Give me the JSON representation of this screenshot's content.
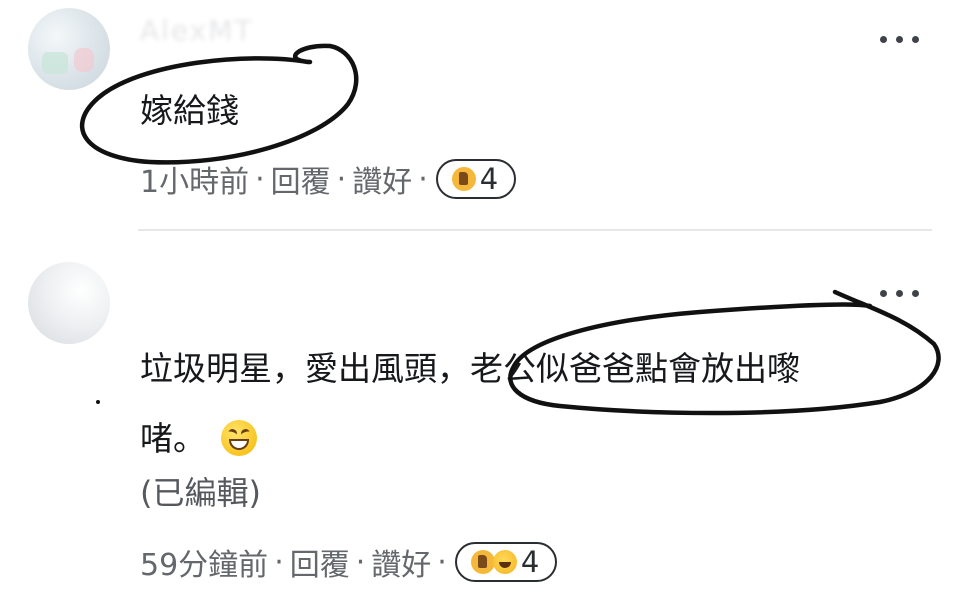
{
  "comments": [
    {
      "username": "AlexMT",
      "text": "嫁給錢",
      "meta": {
        "time": "1小時前",
        "reply": "回覆",
        "like": "讚好",
        "reaction_count": "4",
        "reactions": [
          "like-icon"
        ]
      }
    },
    {
      "username": "",
      "text_line1": "垃圾明星，愛出風頭，老公似爸爸點會放出嚟",
      "text_line2": "啫。",
      "emoji": "grinning-squinting-face-icon",
      "edited": "(已編輯)",
      "meta": {
        "time": "59分鐘前",
        "reply": "回覆",
        "like": "讚好",
        "reaction_count": "4",
        "reactions": [
          "like-icon",
          "laugh-icon"
        ]
      }
    }
  ],
  "separator": "·",
  "colors": {
    "text": "#16181b",
    "meta": "#64676b",
    "ink": "#111111",
    "divider": "#e6e7e9"
  }
}
